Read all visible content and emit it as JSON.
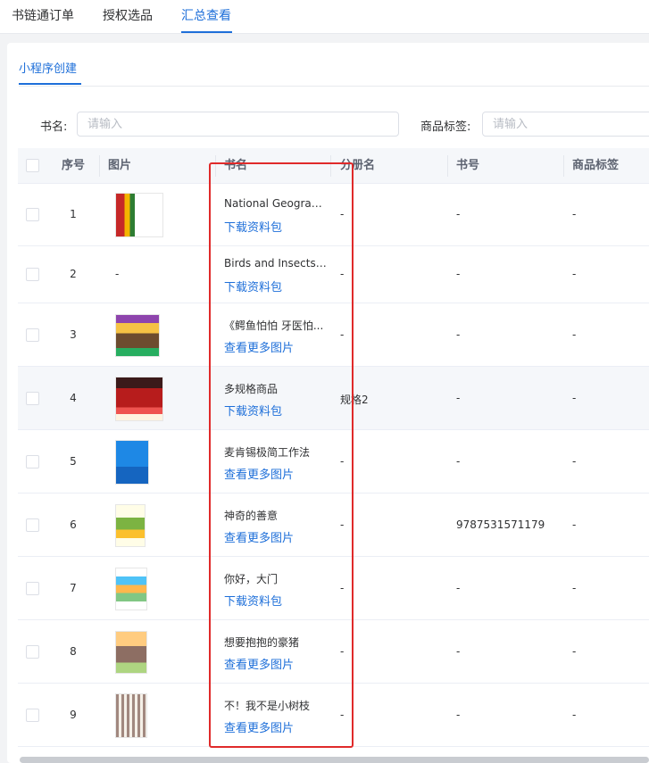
{
  "top_tabs": [
    "书链通订单",
    "授权选品",
    "汇总查看"
  ],
  "sub_tab": "小程序创建",
  "filters": {
    "book_label": "书名:",
    "book_placeholder": "请输入",
    "tag_label": "商品标签:",
    "tag_placeholder": "请输入"
  },
  "columns": [
    "序号",
    "图片",
    "书名",
    "分册名",
    "书号",
    "商品标签"
  ],
  "rows": [
    {
      "seq": "1",
      "image": "-",
      "name": "National Geographi...",
      "action": "下载资料包",
      "volume": "-",
      "isbn": "-",
      "tag": "-"
    },
    {
      "seq": "2",
      "image": "-",
      "name": "Birds and Insects - ...",
      "action": "下载资料包",
      "volume": "-",
      "isbn": "-",
      "tag": "-"
    },
    {
      "seq": "3",
      "image": "-",
      "name": "《鳄鱼怕怕 牙医怕...",
      "action": "查看更多图片",
      "volume": "-",
      "isbn": "-",
      "tag": "-"
    },
    {
      "seq": "4",
      "image": "-",
      "name": "多规格商品",
      "action": "下载资料包",
      "volume": "规格2",
      "isbn": "-",
      "tag": "-"
    },
    {
      "seq": "5",
      "image": "-",
      "name": "麦肯锡极简工作法",
      "action": "查看更多图片",
      "volume": "-",
      "isbn": "-",
      "tag": "-"
    },
    {
      "seq": "6",
      "image": "-",
      "name": "神奇的善意",
      "action": "查看更多图片",
      "volume": "-",
      "isbn": "9787531571179",
      "tag": "-"
    },
    {
      "seq": "7",
      "image": "-",
      "name": "你好，大门",
      "action": "下载资料包",
      "volume": "-",
      "isbn": "-",
      "tag": "-"
    },
    {
      "seq": "8",
      "image": "-",
      "name": "想要抱抱的豪猪",
      "action": "查看更多图片",
      "volume": "-",
      "isbn": "-",
      "tag": "-"
    },
    {
      "seq": "9",
      "image": "-",
      "name": "不！我不是小树枝",
      "action": "查看更多图片",
      "volume": "-",
      "isbn": "-",
      "tag": "-"
    }
  ],
  "colors": {
    "accent": "#1e6fd9",
    "highlight_box": "#e02a2a",
    "header_bg": "#f5f7fa"
  }
}
